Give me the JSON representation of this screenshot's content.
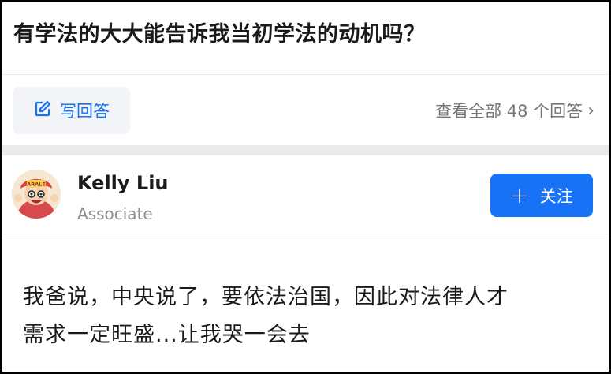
{
  "question": {
    "title": "有学法的大大能告诉我当初学法的动机吗？"
  },
  "actions": {
    "write_answer_label": "写回答",
    "view_all_label": "查看全部 48 个回答",
    "view_all_chevron": "›"
  },
  "author": {
    "name": "Kelly Liu",
    "title": "Associate",
    "avatar_icon": "cartoon-character-avatar-icon"
  },
  "follow": {
    "plus": "+",
    "label": "关注"
  },
  "answer": {
    "lines": [
      "我爸说，中央说了，要依法治国，因此对法律人才",
      "需求一定旺盛...让我哭一会去"
    ]
  },
  "colors": {
    "accent": "#1772f6",
    "text": "#1a1a1a",
    "muted": "#767676",
    "divider": "#ebebeb",
    "button_bg": "#f2f4f7"
  }
}
